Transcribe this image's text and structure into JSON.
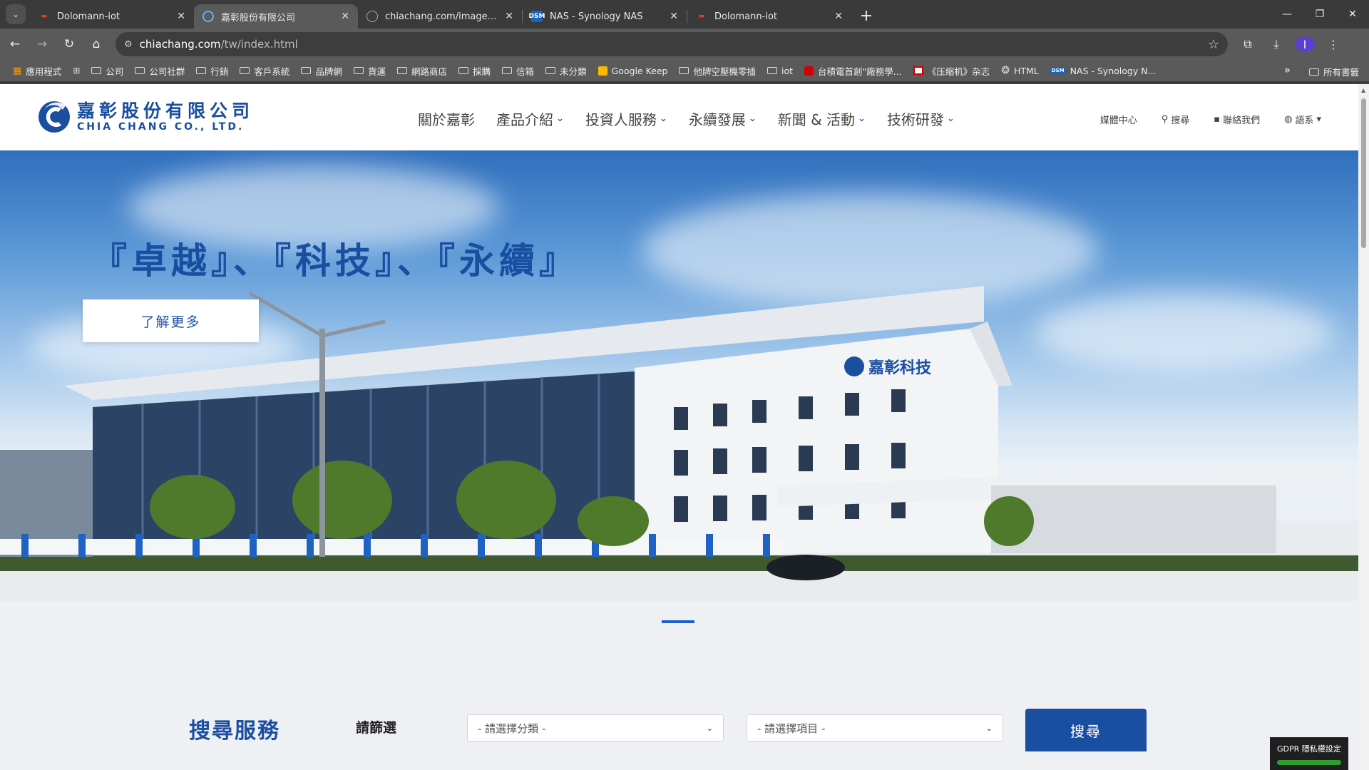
{
  "browser": {
    "tabs": [
      {
        "title": "Dolomann-iot",
        "favicon": "red-dash",
        "active": false
      },
      {
        "title": "嘉彰股份有限公司",
        "favicon": "chia-chang-logo",
        "active": true
      },
      {
        "title": "chiachang.com/images/logo...",
        "favicon": "globe",
        "active": false
      },
      {
        "title": "NAS - Synology NAS",
        "favicon": "dsm",
        "active": false
      },
      {
        "title": "Dolomann-iot",
        "favicon": "red-dash",
        "active": false
      }
    ],
    "url_host": "chiachang.com",
    "url_path": "/tw/index.html",
    "profile_initial": "I",
    "bookmarks": [
      {
        "label": "應用程式",
        "icon": "apps-grid-icon"
      },
      {
        "label": "",
        "icon": "grid-icon"
      },
      {
        "label": "公司",
        "icon": "folder-icon"
      },
      {
        "label": "公司社群",
        "icon": "folder-icon"
      },
      {
        "label": "行銷",
        "icon": "folder-icon"
      },
      {
        "label": "客戶系統",
        "icon": "folder-icon"
      },
      {
        "label": "品牌網",
        "icon": "folder-icon"
      },
      {
        "label": "貨運",
        "icon": "folder-icon"
      },
      {
        "label": "網路商店",
        "icon": "folder-icon"
      },
      {
        "label": "採購",
        "icon": "folder-icon"
      },
      {
        "label": "信箱",
        "icon": "folder-icon"
      },
      {
        "label": "未分類",
        "icon": "folder-icon"
      },
      {
        "label": "Google Keep",
        "icon": "keep-icon"
      },
      {
        "label": "他牌空壓機零插",
        "icon": "folder-icon"
      },
      {
        "label": "iot",
        "icon": "folder-icon"
      },
      {
        "label": "台積電首創\"廠務學...",
        "icon": "red-square-icon"
      },
      {
        "label": "《压缩机》杂志",
        "icon": "news-icon"
      },
      {
        "label": "HTML",
        "icon": "openai-icon"
      },
      {
        "label": "NAS - Synology N...",
        "icon": "dsm-icon"
      }
    ],
    "bookmarks_more": "»",
    "all_bookmarks": "所有書籤"
  },
  "site": {
    "logo_cn": "嘉彰股份有限公司",
    "logo_en": "CHIA CHANG CO., LTD.",
    "nav": [
      {
        "label": "關於嘉彰",
        "has_dropdown": false
      },
      {
        "label": "產品介紹",
        "has_dropdown": true
      },
      {
        "label": "投資人服務",
        "has_dropdown": true
      },
      {
        "label": "永續發展",
        "has_dropdown": true
      },
      {
        "label": "新聞 & 活動",
        "has_dropdown": true
      },
      {
        "label": "技術研發",
        "has_dropdown": true
      }
    ],
    "util": {
      "media": "媒體中心",
      "search": "搜尋",
      "contact": "聯絡我們",
      "language": "語系"
    },
    "hero": {
      "title": "『卓越』、『科技』、『永續』",
      "button": "了解更多",
      "building_sign": "嘉彰科技"
    },
    "search_service": {
      "title": "搜尋服務",
      "filter_label": "請篩選",
      "category_placeholder": "- 請選擇分類 -",
      "item_placeholder": "- 請選擇項目 -",
      "button": "搜尋"
    },
    "gdpr": "GDPR 隱私權設定"
  },
  "colors": {
    "brand_blue": "#1a4ea1",
    "accent_blue": "#1a5fd0",
    "gdpr_green": "#2e9d2e"
  }
}
